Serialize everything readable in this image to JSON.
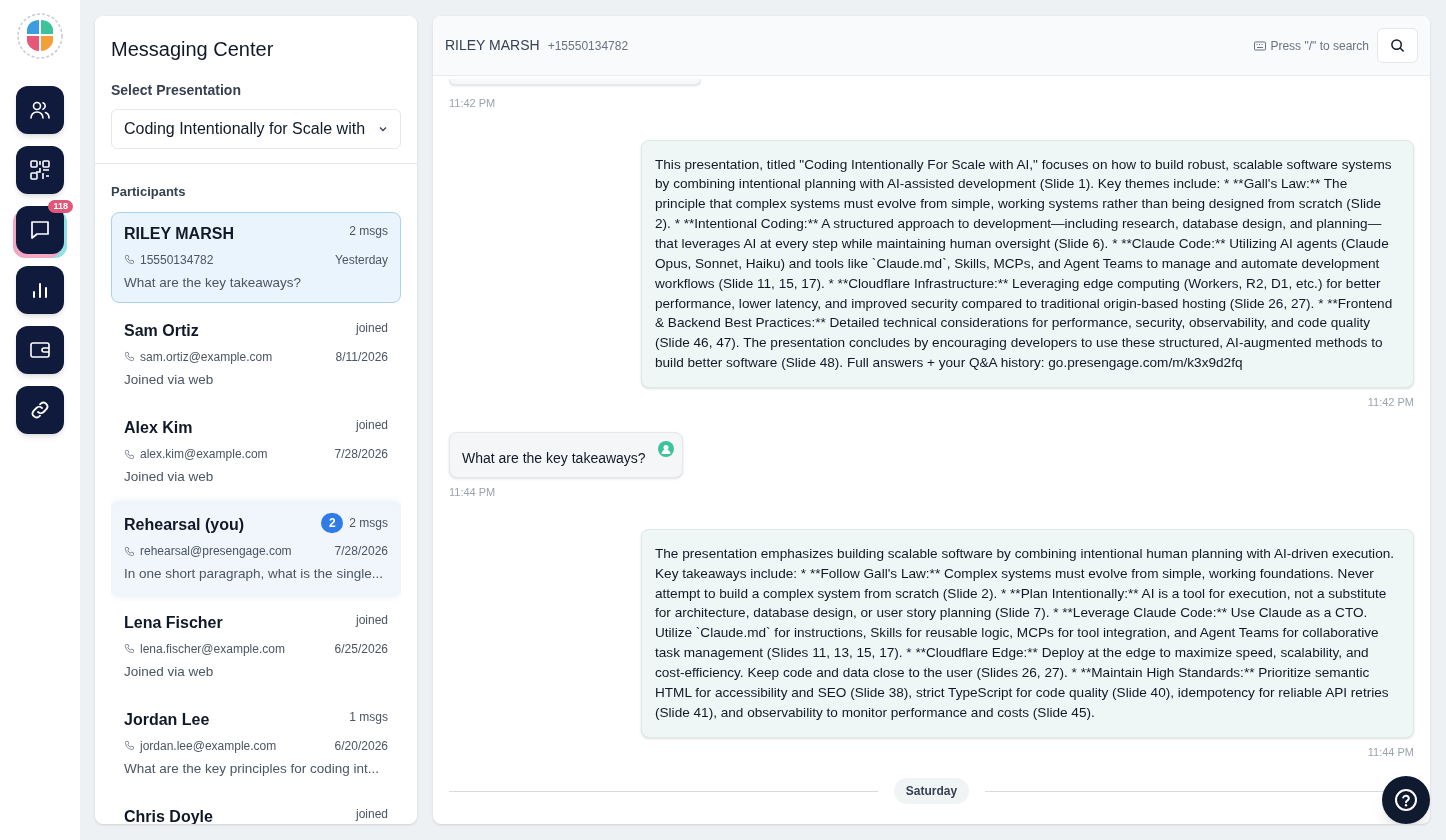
{
  "nav": [
    {
      "kind": "people",
      "selected": false
    },
    {
      "kind": "qr",
      "selected": false
    },
    {
      "kind": "chat",
      "selected": true,
      "badge": "118"
    },
    {
      "kind": "chart",
      "selected": false
    },
    {
      "kind": "wallet",
      "selected": false
    },
    {
      "kind": "link",
      "selected": false
    }
  ],
  "sidebar": {
    "title": "Messaging Center",
    "select_label": "Select Presentation",
    "presentation": "Coding Intentionally for Scale with",
    "participants_label": "Participants",
    "participants": [
      {
        "name": "RILEY MARSH",
        "status": "2 msgs",
        "contact": "15550134782",
        "time": "Yesterday",
        "preview": "What are the key takeaways?",
        "selected": true,
        "highlighted": false
      },
      {
        "name": "Sam Ortiz",
        "status": "joined",
        "contact": "sam.ortiz@example.com",
        "time": "8/11/2026",
        "preview": "Joined via web",
        "selected": false,
        "highlighted": false
      },
      {
        "name": "Alex Kim",
        "status": "joined",
        "contact": "alex.kim@example.com",
        "time": "7/28/2026",
        "preview": "Joined via web",
        "selected": false,
        "highlighted": false
      },
      {
        "name": "Rehearsal (you)",
        "unread": "2",
        "status": "2 msgs",
        "contact": "rehearsal@presengage.com",
        "time": "7/28/2026",
        "preview": "In one short paragraph, what is the single...",
        "selected": false,
        "highlighted": true
      },
      {
        "name": "Lena Fischer",
        "status": "joined",
        "contact": "lena.fischer@example.com",
        "time": "6/25/2026",
        "preview": "Joined via web",
        "selected": false,
        "highlighted": false
      },
      {
        "name": "Jordan Lee",
        "status": "1 msgs",
        "contact": "jordan.lee@example.com",
        "time": "6/20/2026",
        "preview": "What are the key principles for coding int...",
        "selected": false,
        "highlighted": false
      },
      {
        "name": "Chris Doyle",
        "status": "joined"
      }
    ]
  },
  "chat": {
    "name": "RILEY MARSH",
    "phone": "+15550134782",
    "search_hint": "Press \"/\" to search",
    "messages": [
      {
        "kind": "time_only",
        "time": "11:42 PM"
      },
      {
        "kind": "reply",
        "text": "This presentation, titled \"Coding Intentionally For Scale with AI,\" focuses on how to build robust, scalable software systems by combining intentional planning with AI-assisted development (Slide 1). Key themes include: * **Gall's Law:** The principle that complex systems must evolve from simple, working systems rather than being designed from scratch (Slide 2). * **Intentional Coding:** A structured approach to development—including research, database design, and planning—that leverages AI at every step while maintaining human oversight (Slide 6). * **Claude Code:** Utilizing AI agents (Claude Opus, Sonnet, Haiku) and tools like `Claude.md`, Skills, MCPs, and Agent Teams to manage and automate development workflows (Slide 11, 15, 17). * **Cloudflare Infrastructure:** Leveraging edge computing (Workers, R2, D1, etc.) for better performance, lower latency, and improved security compared to traditional origin-based hosting (Slide 26, 27). * **Frontend & Backend Best Practices:** Detailed technical considerations for performance, security, observability, and code quality (Slide 46, 47). The presentation concludes by encouraging developers to use these structured, AI-augmented methods to build better software (Slide 48). Full answers + your Q&A history: go.presengage.com/m/k3x9d2fq",
        "time": "11:42 PM"
      },
      {
        "kind": "question",
        "text": "What are the key takeaways?",
        "time": "11:44 PM"
      },
      {
        "kind": "reply",
        "text": "The presentation emphasizes building scalable software by combining intentional human planning with AI-driven execution. Key takeaways include: * **Follow Gall's Law:** Complex systems must evolve from simple, working foundations. Never attempt to build a complex system from scratch (Slide 2). * **Plan Intentionally:** AI is a tool for execution, not a substitute for architecture, database design, or user story planning (Slide 7). * **Leverage Claude Code:** Use Claude as a CTO. Utilize `Claude.md` for instructions, Skills for reusable logic, MCPs for tool integration, and Agent Teams for collaborative task management (Slides 11, 13, 15, 17). * **Cloudflare Edge:** Deploy at the edge to maximize speed, scalability, and cost-efficiency. Keep code and data close to the user (Slides 26, 27). * **Maintain High Standards:** Prioritize semantic HTML for accessibility and SEO (Slide 38), strict TypeScript for code quality (Slide 40), idempotency for reliable API retries (Slide 41), and observability to monitor performance and costs (Slide 45).",
        "time": "11:44 PM"
      },
      {
        "kind": "divider",
        "label": "Saturday"
      }
    ]
  }
}
